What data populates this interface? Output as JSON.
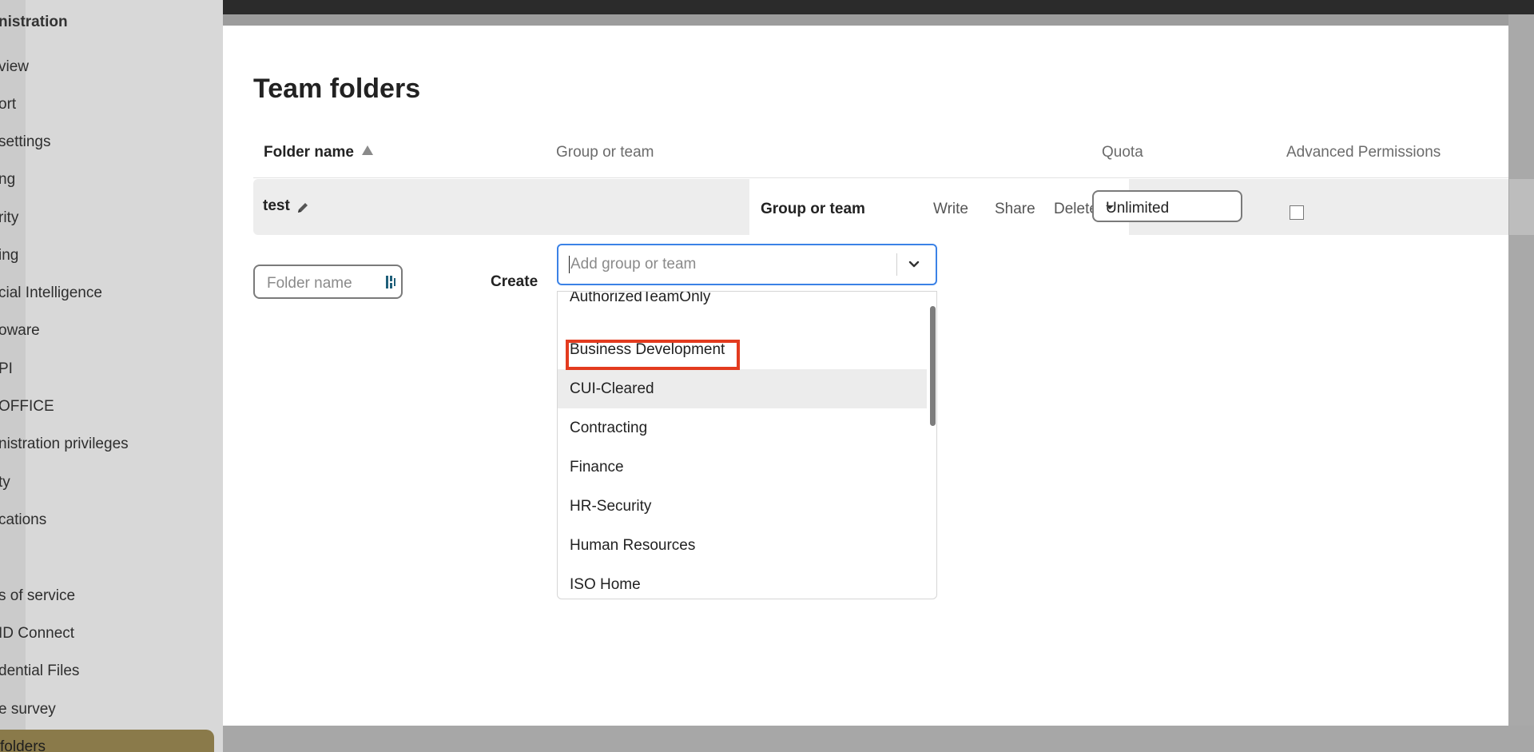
{
  "sidebar": {
    "title": "nistration",
    "items": [
      "view",
      "ort",
      " settings",
      "ng",
      "rity",
      "ing",
      "cial Intelligence",
      "oware",
      "PI",
      "OFFICE",
      "nistration privileges",
      "ty",
      "cations",
      "s of service",
      "ID Connect",
      "dential Files",
      "e survey"
    ],
    "active_item": "folders"
  },
  "page": {
    "title": "Team folders"
  },
  "table": {
    "headers": {
      "folder_name": "Folder name",
      "group_or_team": "Group or team",
      "quota": "Quota",
      "advanced_permissions": "Advanced Permissions"
    },
    "row": {
      "name": "test",
      "permissions_header": {
        "group": "Group or team",
        "write": "Write",
        "share": "Share",
        "delete": "Delete"
      },
      "quota": "Unlimited",
      "advanced_permissions_checked": false
    }
  },
  "new_folder": {
    "placeholder": "Folder name",
    "create_label": "Create"
  },
  "group_search": {
    "placeholder": "Add group or team",
    "options": [
      "AuthorizedTeamOnly",
      "Business Development",
      "CUI-Cleared",
      "Contracting",
      "Finance",
      "HR-Security",
      "Human Resources",
      "ISO Home"
    ],
    "hovered_option": "CUI-Cleared",
    "highlighted_option": "Business Development"
  },
  "colors": {
    "accent_blue": "#3b82e6",
    "highlight_red": "#e33b1f",
    "active_nav": "#8a7a4a"
  }
}
